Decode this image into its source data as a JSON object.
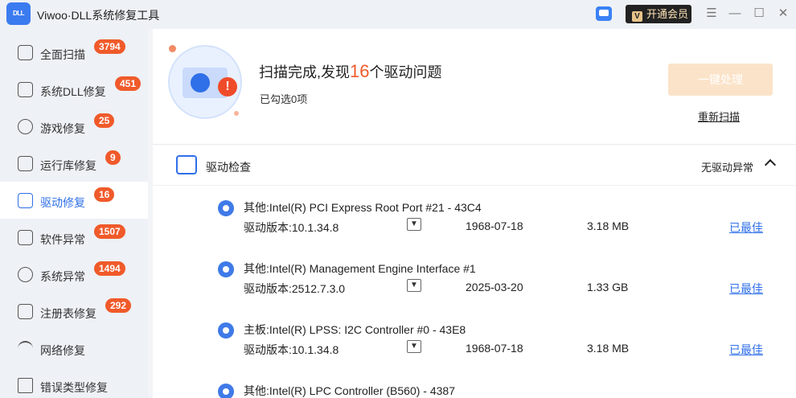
{
  "app": {
    "title": "Viwoo·DLL系统修复工具",
    "logo_text": "DLL"
  },
  "titlebar": {
    "vip_label": "开通会员",
    "vip_mark": "V",
    "menu_glyph": "☰",
    "min_glyph": "—",
    "max_glyph": "☐",
    "close_glyph": "✕"
  },
  "sidebar": {
    "items": [
      {
        "label": "全面扫描",
        "badge": "3794",
        "icon": "scan-icon"
      },
      {
        "label": "系统DLL修复",
        "badge": "451",
        "icon": "dll-icon"
      },
      {
        "label": "游戏修复",
        "badge": "25",
        "icon": "game-icon"
      },
      {
        "label": "运行库修复",
        "badge": "9",
        "icon": "runtime-icon"
      },
      {
        "label": "驱动修复",
        "badge": "16",
        "icon": "driver-icon"
      },
      {
        "label": "软件异常",
        "badge": "1507",
        "icon": "software-icon"
      },
      {
        "label": "系统异常",
        "badge": "1494",
        "icon": "system-gear-icon"
      },
      {
        "label": "注册表修复",
        "badge": "292",
        "icon": "registry-icon"
      },
      {
        "label": "网络修复",
        "badge": "",
        "icon": "wifi-icon"
      },
      {
        "label": "错误类型修复",
        "badge": "",
        "icon": "warning-icon"
      }
    ],
    "active_index": 4
  },
  "scan": {
    "title_prefix": "扫描完成,发现",
    "count": "16",
    "title_suffix": "个驱动问题",
    "selected_text": "已勾选0项",
    "fix_button": "一键处理",
    "rescan_link": "重新扫描",
    "warning_mark": "!"
  },
  "section": {
    "title": "驱动检查",
    "status": "无驱动异常"
  },
  "drivers": [
    {
      "name": "其他:Intel(R) PCI Express Root Port #21 - 43C4",
      "version_label": "驱动版本:",
      "version": "10.1.34.8",
      "date": "1968-07-18",
      "size": "3.18 MB",
      "status": "已最佳"
    },
    {
      "name": "其他:Intel(R) Management Engine Interface #1",
      "version_label": "驱动版本:",
      "version": "2512.7.3.0",
      "date": "2025-03-20",
      "size": "1.33 GB",
      "status": "已最佳"
    },
    {
      "name": "主板:Intel(R) LPSS: I2C Controller #0 - 43E8",
      "version_label": "驱动版本:",
      "version": "10.1.34.8",
      "date": "1968-07-18",
      "size": "3.18 MB",
      "status": "已最佳"
    },
    {
      "name": "其他:Intel(R) LPC Controller (B560) - 4387",
      "version_label": "",
      "version": "",
      "date": "",
      "size": "",
      "status": ""
    }
  ],
  "colors": {
    "accent": "#2f6fe8",
    "badge": "#f05a2a",
    "highlight": "#f05a2a",
    "fix_button": "#fbe3c9"
  }
}
